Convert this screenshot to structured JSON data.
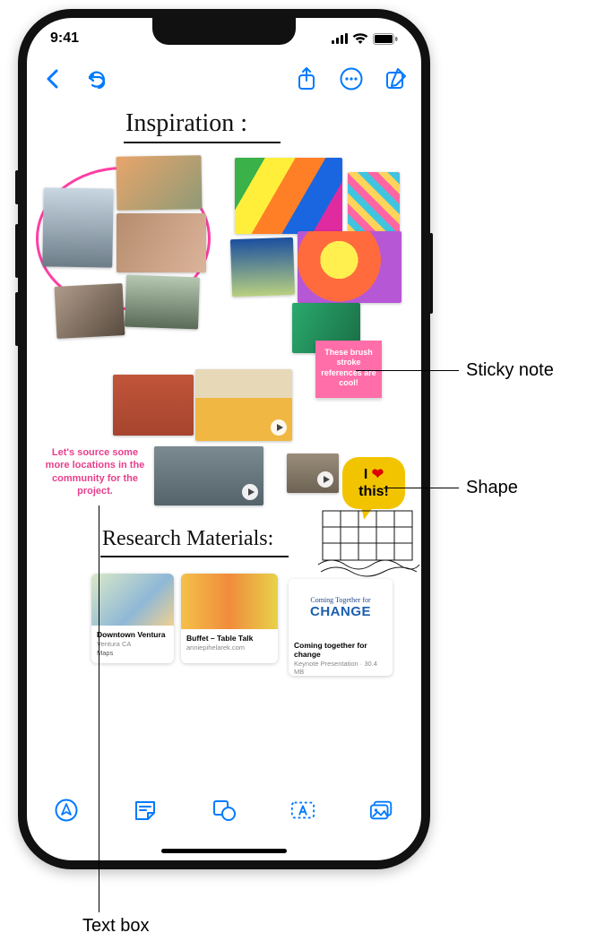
{
  "status": {
    "time": "9:41"
  },
  "canvas": {
    "heading_inspiration": "Inspiration :",
    "heading_research": "Research Materials:",
    "sticky_text": "These brush stroke references are cool!",
    "textbox_text": "Let's source some more locations in the community for the project.",
    "speech_line1": "I ",
    "speech_heart": "❤",
    "speech_line2": "this!"
  },
  "cards": {
    "c1_title": "Downtown Ventura",
    "c1_sub": "Ventura CA",
    "c1_app": "Maps",
    "c2_title": "Buffet – Table Talk",
    "c2_sub": "anniepihelarek.com",
    "c3_pre": "Coming Together for",
    "c3_big": "CHANGE",
    "c3_title": "Coming together for change",
    "c3_sub": "Keynote Presentation · 30.4 MB"
  },
  "callouts": {
    "sticky": "Sticky note",
    "shape": "Shape",
    "textbox": "Text box"
  }
}
